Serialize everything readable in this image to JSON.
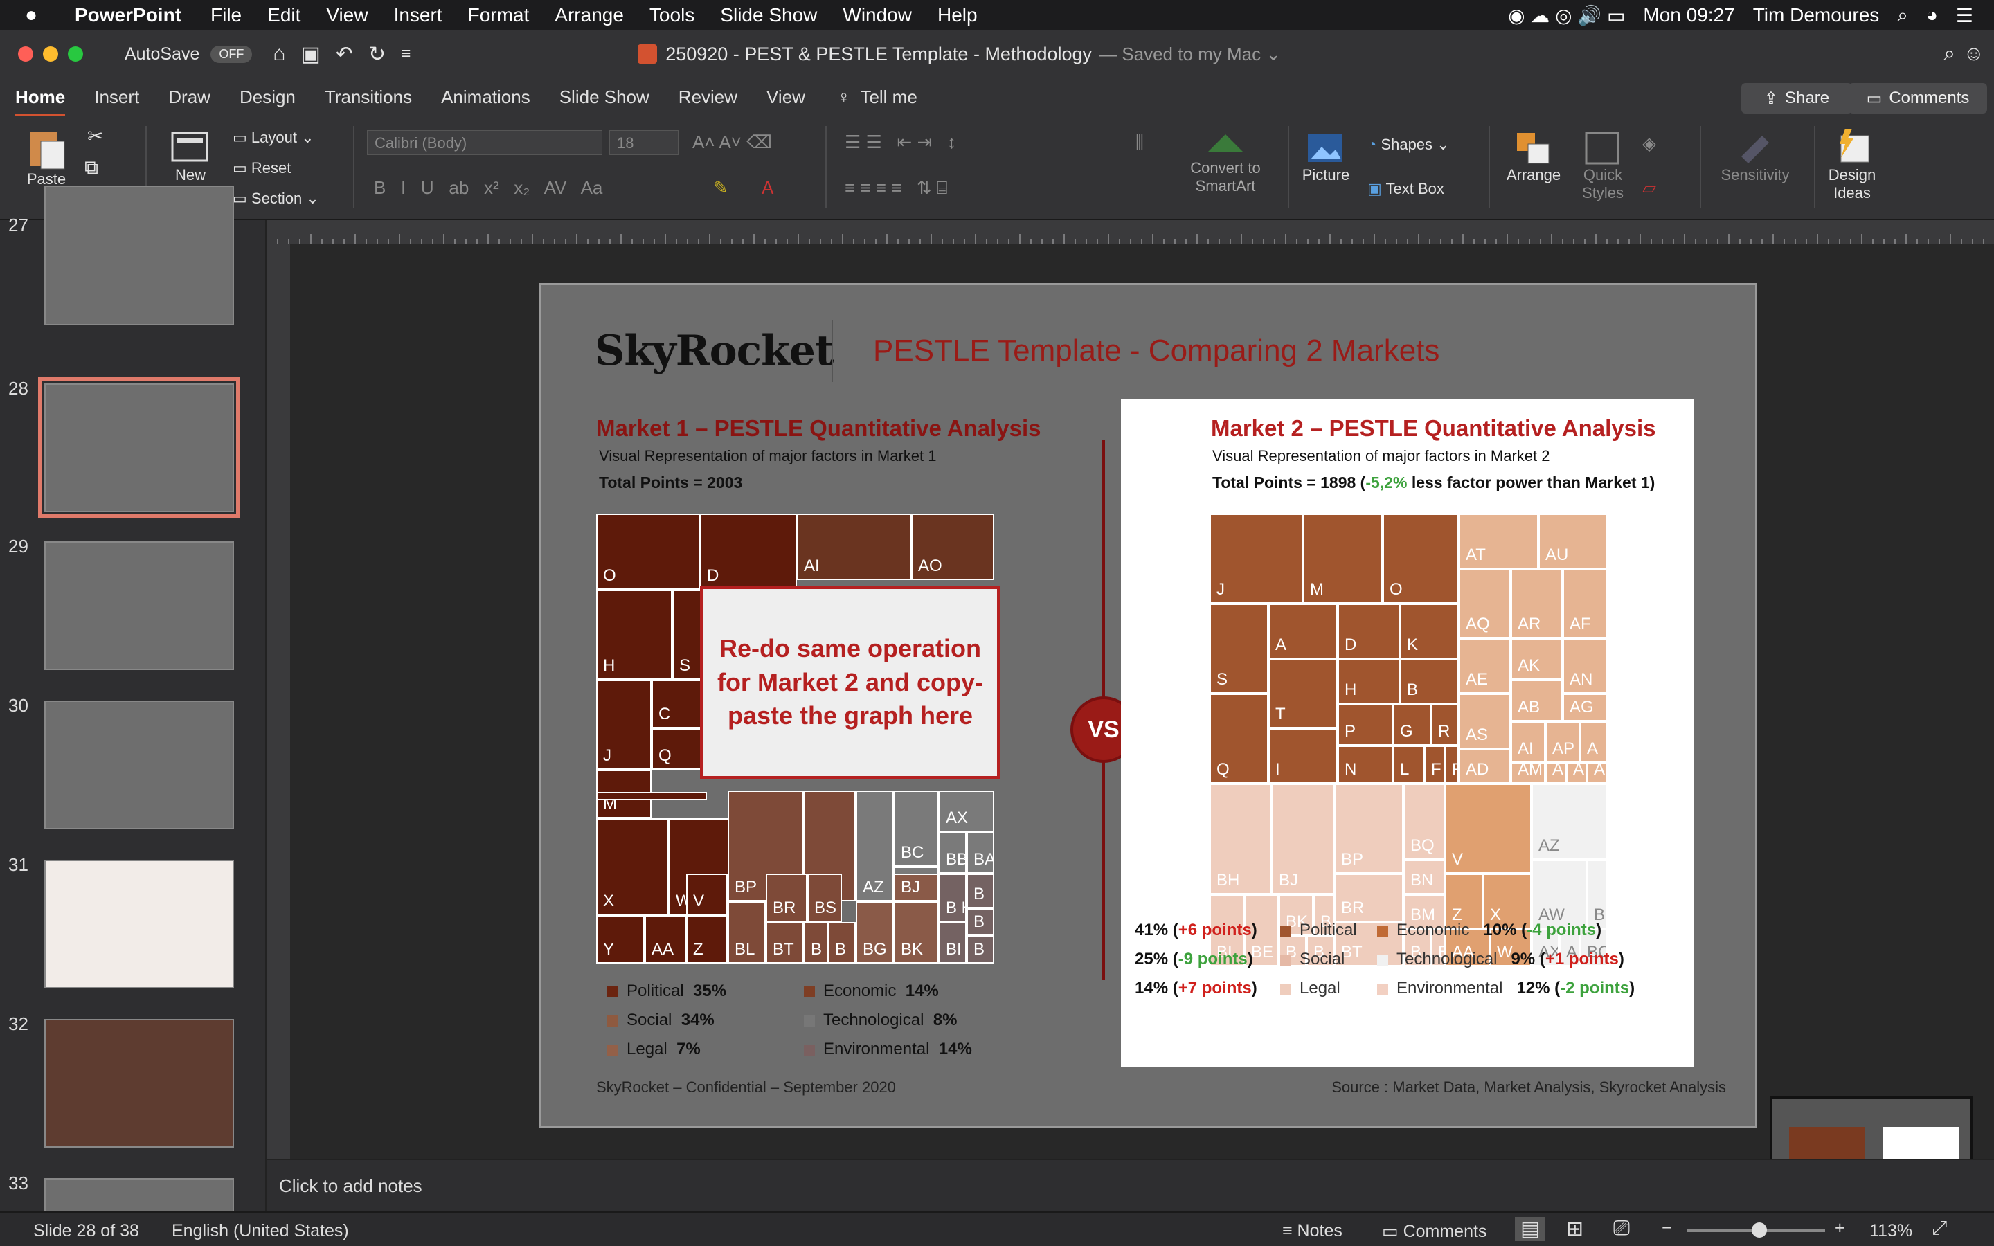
{
  "menubar": {
    "app": "PowerPoint",
    "items": [
      "File",
      "Edit",
      "View",
      "Insert",
      "Format",
      "Arrange",
      "Tools",
      "Slide Show",
      "Window",
      "Help"
    ],
    "clock": "Mon 09:27",
    "user": "Tim Demoures"
  },
  "titlebar": {
    "autosave": "AutoSave",
    "autosave_state": "OFF",
    "doc_title": "250920 - PEST & PESTLE Template - Methodology",
    "saved": "— Saved to my Mac ⌄"
  },
  "tabs": [
    "Home",
    "Insert",
    "Draw",
    "Design",
    "Transitions",
    "Animations",
    "Slide Show",
    "Review",
    "View",
    "Tell me"
  ],
  "share": "Share",
  "comments": "Comments",
  "ribbon": {
    "paste": "Paste",
    "new_slide": "New Slide",
    "layout": "Layout",
    "reset": "Reset",
    "section": "Section",
    "font": "Calibri (Body)",
    "font_size": "18",
    "convert": "Convert to SmartArt",
    "picture": "Picture",
    "shapes": "Shapes",
    "textbox": "Text Box",
    "arrange": "Arrange",
    "quick_styles": "Quick Styles",
    "sensitivity": "Sensitivity",
    "design_ideas": "Design Ideas"
  },
  "thumbs": [
    "27",
    "28",
    "29",
    "30",
    "31",
    "32",
    "33"
  ],
  "slide": {
    "logo": "SkyRocket",
    "title": "PESTLE Template - Comparing 2 Markets",
    "m1": {
      "title": "Market 1 – PESTLE Quantitative Analysis",
      "sub": "Visual Representation of major factors in Market 1",
      "total": "Total Points = 2003"
    },
    "m2": {
      "title": "Market 2 – PESTLE Quantitative Analysis",
      "sub": "Visual Representation of major factors in Market 2",
      "total_a": "Total Points = 1898 (",
      "total_b": "-5,2%",
      "total_c": " less factor power than Market 1)"
    },
    "redo": "Re-do same operation for Market 2 and copy-paste the graph here",
    "vs": "VS",
    "legend1": [
      [
        "Political",
        "35%"
      ],
      [
        "Economic",
        "14%"
      ],
      [
        "Social",
        "34%"
      ],
      [
        "Technological",
        "8%"
      ],
      [
        "Legal",
        "7%"
      ],
      [
        "Environmental",
        "14%"
      ]
    ],
    "legend2": [
      {
        "pct": "41%",
        "delta": "+6 points",
        "label": "Political"
      },
      {
        "pct": "25%",
        "delta": "-9 points",
        "label": "Social"
      },
      {
        "pct": "14%",
        "delta": "+7 points",
        "label": "Legal"
      },
      {
        "pct": "10%",
        "delta": "-4 points",
        "label": "Economic"
      },
      {
        "pct": "9%",
        "delta": "+1 points",
        "label": "Technological"
      },
      {
        "pct": "12%",
        "delta": "-2 points",
        "label": "Environmental"
      }
    ],
    "footer_left": "SkyRocket – Confidential – September 2020",
    "footer_right": "Source : Market Data, Market Analysis, Skyrocket Analysis"
  },
  "notes": "Click to add notes",
  "status": {
    "slide": "Slide 28 of 38",
    "lang": "English (United States)",
    "notes": "Notes",
    "comments": "Comments",
    "zoom": "113%"
  },
  "colors": {
    "accent": "#d35230",
    "dark": "#6b2410",
    "red": "#b52020"
  }
}
